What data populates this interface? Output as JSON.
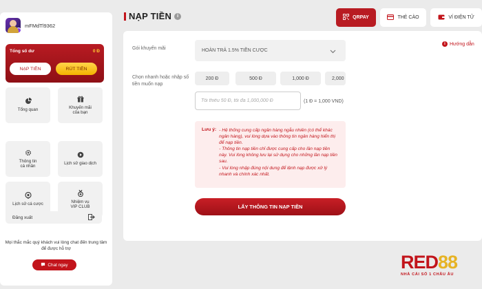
{
  "sidebar": {
    "username": "mFMdTl9362",
    "balance_label": "Tổng số dư",
    "balance_value": "0 Đ",
    "deposit_label": "NẠP TIỀN",
    "withdraw_label": "RÚT TIỀN",
    "items": [
      {
        "label": "Tổng quan",
        "icon": "pie-chart-icon"
      },
      {
        "label": "Khuyến mãi\ncủa bạn",
        "icon": "gift-icon"
      },
      {
        "label": "Thông tin\ncá nhân",
        "icon": "gear-icon"
      },
      {
        "label": "Lịch sử giao dịch",
        "icon": "history-icon"
      },
      {
        "label": "Lịch sử cá cược",
        "icon": "location-pin-icon"
      },
      {
        "label": "Nhiệm vụ\nVIP CLUB",
        "icon": "medal-icon"
      }
    ],
    "logout_label": "Đăng xuất",
    "support_text": "Mọi thắc mắc quý khách vui lòng chat đến trung tâm để được hỗ trợ",
    "chat_label": "Chat ngay"
  },
  "header": {
    "title": "NẠP TIỀN"
  },
  "methods": [
    {
      "label": "QRPAY",
      "icon": "qr-icon",
      "active": true
    },
    {
      "label": "THẺ CÀO",
      "icon": "card-icon",
      "active": false
    },
    {
      "label": "VÍ ĐIỆN TỬ",
      "icon": "wallet-icon",
      "active": false
    }
  ],
  "form": {
    "promo_label": "Gói khuyến mãi",
    "promo_value": "HOÀN TRẢ 1.5% TIỀN CƯỢC",
    "guide_label": "Hướng dẫn",
    "quick_label": "Chọn nhanh hoặc nhập số tiền muốn nạp",
    "quick_amounts": [
      "200 Đ",
      "500 Đ",
      "1,000 Đ",
      "2,000"
    ],
    "amount_placeholder": "Tối thiểu 50 Đ, tối đa 1,000,000 Đ",
    "rate_text": "(1 Đ = 1,000 VND)",
    "note_title": "Lưu ý:",
    "note_lines": [
      "- Hệ thống cung cấp ngân hàng ngẫu nhiên (có thể khác ngân hàng), vui lòng dựa vào thông tin ngân hàng hiển thị để nạp tiền.",
      "- Thông tin nạp tiền chỉ được cung cấp cho lần nạp tiền này. Vui lòng không lưu lại sử dụng cho những lần nạp tiền sau.",
      "- Vui lòng nhập đúng nội dung để lệnh nạp được xử lý nhanh và chính xác nhất."
    ],
    "submit_label": "LẤY THÔNG TIN NẠP TIỀN"
  },
  "brand": {
    "name_part1": "RED",
    "name_part2": "88",
    "tagline": "NHÀ CÁI SỐ 1 CHÂU ÂU"
  },
  "colors": {
    "primary": "#c2141b",
    "gold": "#f4b400",
    "background": "#ebebeb"
  }
}
